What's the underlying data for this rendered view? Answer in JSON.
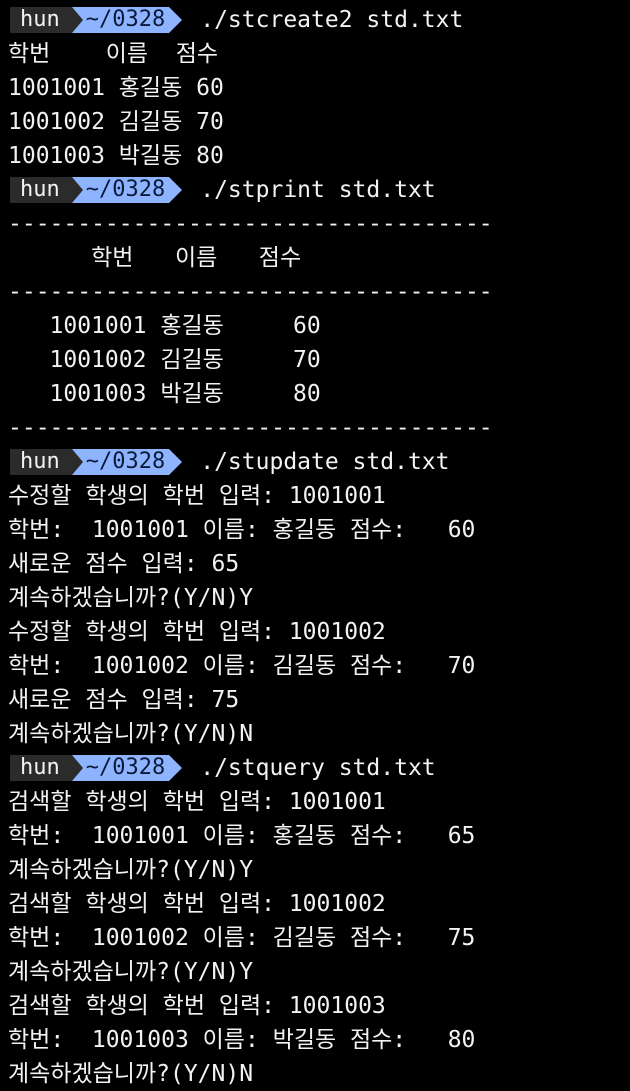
{
  "prompt": {
    "user": "hun",
    "dir": "~/0328"
  },
  "lines": [
    {
      "type": "prompt",
      "cmd": "./stcreate2 std.txt"
    },
    {
      "type": "text",
      "text": "학번    이름  점수"
    },
    {
      "type": "text",
      "text": "1001001 홍길동 60"
    },
    {
      "type": "text",
      "text": "1001002 김길동 70"
    },
    {
      "type": "text",
      "text": "1001003 박길동 80"
    },
    {
      "type": "prompt",
      "cmd": "./stprint std.txt"
    },
    {
      "type": "text",
      "text": "-----------------------------------"
    },
    {
      "type": "text",
      "text": "      학번   이름   점수"
    },
    {
      "type": "text",
      "text": "-----------------------------------"
    },
    {
      "type": "text",
      "text": "   1001001 홍길동     60"
    },
    {
      "type": "text",
      "text": "   1001002 김길동     70"
    },
    {
      "type": "text",
      "text": "   1001003 박길동     80"
    },
    {
      "type": "text",
      "text": "-----------------------------------"
    },
    {
      "type": "prompt",
      "cmd": "./stupdate std.txt"
    },
    {
      "type": "text",
      "text": "수정할 학생의 학번 입력: 1001001"
    },
    {
      "type": "text",
      "text": "학번:  1001001 이름: 홍길동 점수:   60"
    },
    {
      "type": "text",
      "text": "새로운 점수 입력: 65"
    },
    {
      "type": "text",
      "text": "계속하겠습니까?(Y/N)Y"
    },
    {
      "type": "text",
      "text": "수정할 학생의 학번 입력: 1001002"
    },
    {
      "type": "text",
      "text": "학번:  1001002 이름: 김길동 점수:   70"
    },
    {
      "type": "text",
      "text": "새로운 점수 입력: 75"
    },
    {
      "type": "text",
      "text": "계속하겠습니까?(Y/N)N"
    },
    {
      "type": "prompt",
      "cmd": "./stquery std.txt"
    },
    {
      "type": "text",
      "text": "검색할 학생의 학번 입력: 1001001"
    },
    {
      "type": "text",
      "text": "학번:  1001001 이름: 홍길동 점수:   65"
    },
    {
      "type": "text",
      "text": "계속하겠습니까?(Y/N)Y"
    },
    {
      "type": "text",
      "text": "검색할 학생의 학번 입력: 1001002"
    },
    {
      "type": "text",
      "text": "학번:  1001002 이름: 김길동 점수:   75"
    },
    {
      "type": "text",
      "text": "계속하겠습니까?(Y/N)Y"
    },
    {
      "type": "text",
      "text": "검색할 학생의 학번 입력: 1001003"
    },
    {
      "type": "text",
      "text": "학번:  1001003 이름: 박길동 점수:   80"
    },
    {
      "type": "text",
      "text": "계속하겠습니까?(Y/N)N"
    }
  ],
  "colors": {
    "background": "#000000",
    "text": "#f2f2f2",
    "prompt_user_bg": "#2b2b2b",
    "prompt_dir_bg": "#8fb4ff",
    "prompt_dir_fg": "#0b1a3a"
  }
}
